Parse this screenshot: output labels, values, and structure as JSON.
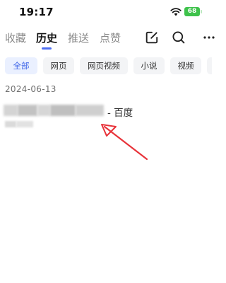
{
  "status_bar": {
    "time": "19:17",
    "battery": "68",
    "battery_color": "#3ec24b"
  },
  "tabs": [
    {
      "label": "收藏",
      "active": false
    },
    {
      "label": "历史",
      "active": true
    },
    {
      "label": "推送",
      "active": false
    },
    {
      "label": "点赞",
      "active": false
    }
  ],
  "toolbar": {
    "edit_icon": "edit-icon",
    "search_icon": "search-icon"
  },
  "filters": [
    {
      "label": "全部",
      "active": true
    },
    {
      "label": "网页",
      "active": false
    },
    {
      "label": "网页视频",
      "active": false
    },
    {
      "label": "小说",
      "active": false
    },
    {
      "label": "视频",
      "active": false
    }
  ],
  "history": {
    "date": "2024-06-13",
    "entries": [
      {
        "title_suffix": "- 百度"
      }
    ]
  },
  "colors": {
    "accent": "#4e6ef2",
    "active_chip_bg": "#eaf0ff",
    "annotation": "#e8333a"
  }
}
